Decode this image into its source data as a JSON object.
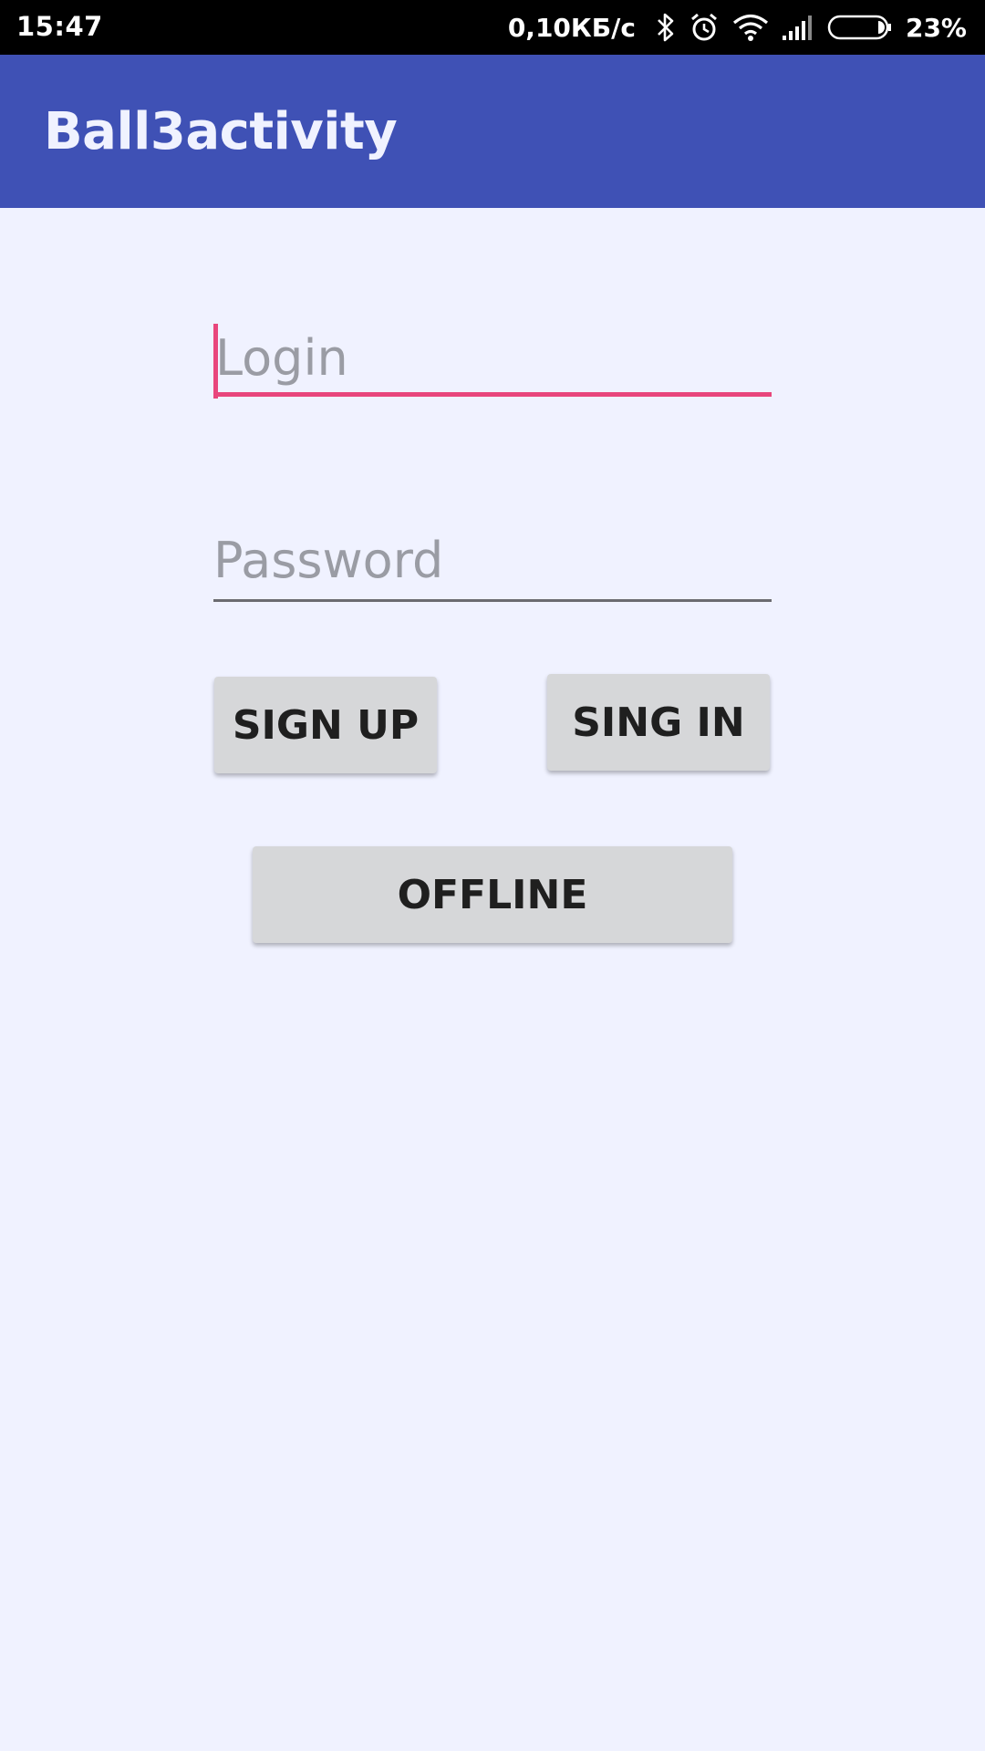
{
  "status_bar": {
    "time": "15:47",
    "network_speed": "0,10КБ/с",
    "battery_percent": "23%",
    "battery_level": 0.23,
    "icons": [
      "bluetooth-icon",
      "alarm-icon",
      "wifi-icon",
      "signal-icon",
      "battery-icon"
    ]
  },
  "app_bar": {
    "title": "Ball3activity",
    "color": "#3f51b5"
  },
  "form": {
    "login_placeholder": "Login",
    "login_value": "",
    "password_placeholder": "Password",
    "password_value": "",
    "focus_color": "#e8467c"
  },
  "buttons": {
    "sign_up": "SIGN UP",
    "sign_in": "SING IN",
    "offline": "OFFLINE"
  }
}
